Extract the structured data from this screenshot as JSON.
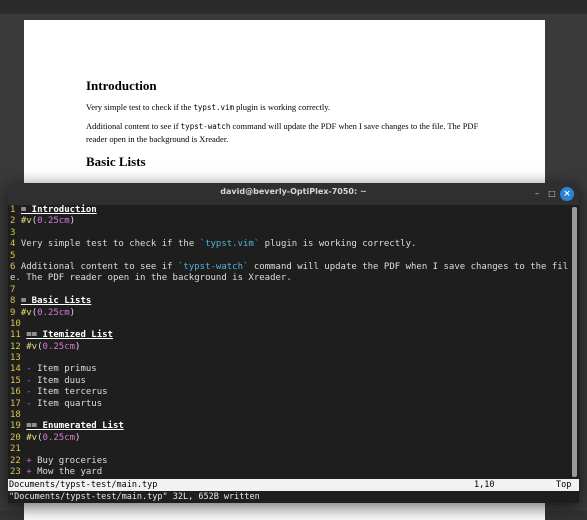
{
  "pdf": {
    "heading1": "Introduction",
    "p1_before": "Very simple test to check if the ",
    "p1_code": "typst.vim",
    "p1_after": " plugin is working correctly.",
    "p2_before": "Additional content to see if ",
    "p2_code": "typst-watch",
    "p2_after": " command will update the PDF when I save changes to the file. The PDF reader open in the background is Xreader.",
    "heading2": "Basic Lists"
  },
  "terminal": {
    "title": "david@beverly-OptiPlex-7050: ~",
    "minimize_icon": "–",
    "maximize_icon": "□",
    "close_icon": "×"
  },
  "editor": {
    "lines": [
      {
        "n": "1",
        "segs": [
          {
            "t": "= Introduction",
            "c": "h"
          }
        ]
      },
      {
        "n": "2",
        "segs": [
          {
            "t": "#v",
            "c": "fn"
          },
          {
            "t": "(",
            "c": ""
          },
          {
            "t": "0.25cm",
            "c": "num"
          },
          {
            "t": ")",
            "c": ""
          }
        ]
      },
      {
        "n": "3",
        "segs": []
      },
      {
        "n": "4",
        "segs": [
          {
            "t": "Very simple test to check if the ",
            "c": ""
          },
          {
            "t": "`typst.vim`",
            "c": "code"
          },
          {
            "t": " plugin is working correctly.",
            "c": ""
          }
        ]
      },
      {
        "n": "5",
        "segs": []
      },
      {
        "n": "6",
        "segs": [
          {
            "t": "Additional content to see if ",
            "c": ""
          },
          {
            "t": "`typst-watch`",
            "c": "code"
          },
          {
            "t": " command will update the PDF when I save changes to the fil",
            "c": ""
          }
        ]
      },
      {
        "n": "",
        "segs": [
          {
            "t": "e. The PDF reader open in the background is Xreader.",
            "c": ""
          }
        ]
      },
      {
        "n": "7",
        "segs": []
      },
      {
        "n": "8",
        "segs": [
          {
            "t": "= Basic Lists",
            "c": "h"
          }
        ]
      },
      {
        "n": "9",
        "segs": [
          {
            "t": "#v",
            "c": "fn"
          },
          {
            "t": "(",
            "c": ""
          },
          {
            "t": "0.25cm",
            "c": "num"
          },
          {
            "t": ")",
            "c": ""
          }
        ]
      },
      {
        "n": "10",
        "segs": []
      },
      {
        "n": "11",
        "segs": [
          {
            "t": "== Itemized List",
            "c": "h"
          }
        ]
      },
      {
        "n": "12",
        "segs": [
          {
            "t": "#v",
            "c": "fn"
          },
          {
            "t": "(",
            "c": ""
          },
          {
            "t": "0.25cm",
            "c": "num"
          },
          {
            "t": ")",
            "c": ""
          }
        ]
      },
      {
        "n": "13",
        "segs": []
      },
      {
        "n": "14",
        "segs": [
          {
            "t": "-",
            "c": "bullet"
          },
          {
            "t": " Item primus",
            "c": ""
          }
        ]
      },
      {
        "n": "15",
        "segs": [
          {
            "t": "-",
            "c": "bullet"
          },
          {
            "t": " Item duus",
            "c": ""
          }
        ]
      },
      {
        "n": "16",
        "segs": [
          {
            "t": "-",
            "c": "bullet"
          },
          {
            "t": " Item tercerus",
            "c": ""
          }
        ]
      },
      {
        "n": "17",
        "segs": [
          {
            "t": "-",
            "c": "bullet"
          },
          {
            "t": " Item quartus",
            "c": ""
          }
        ]
      },
      {
        "n": "18",
        "segs": []
      },
      {
        "n": "19",
        "segs": [
          {
            "t": "== Enumerated List",
            "c": "h"
          }
        ]
      },
      {
        "n": "20",
        "segs": [
          {
            "t": "#v",
            "c": "fn"
          },
          {
            "t": "(",
            "c": ""
          },
          {
            "t": "0.25cm",
            "c": "num"
          },
          {
            "t": ")",
            "c": ""
          }
        ]
      },
      {
        "n": "21",
        "segs": []
      },
      {
        "n": "22",
        "segs": [
          {
            "t": "+",
            "c": "bullet"
          },
          {
            "t": " Buy groceries",
            "c": ""
          }
        ]
      },
      {
        "n": "23",
        "segs": [
          {
            "t": "+",
            "c": "bullet"
          },
          {
            "t": " Mow the yard",
            "c": ""
          }
        ]
      }
    ]
  },
  "status": {
    "file": "Documents/typst-test/main.typ",
    "position": "1,10",
    "scroll": "Top",
    "message": "\"Documents/typst-test/main.typ\" 32L, 652B written"
  }
}
